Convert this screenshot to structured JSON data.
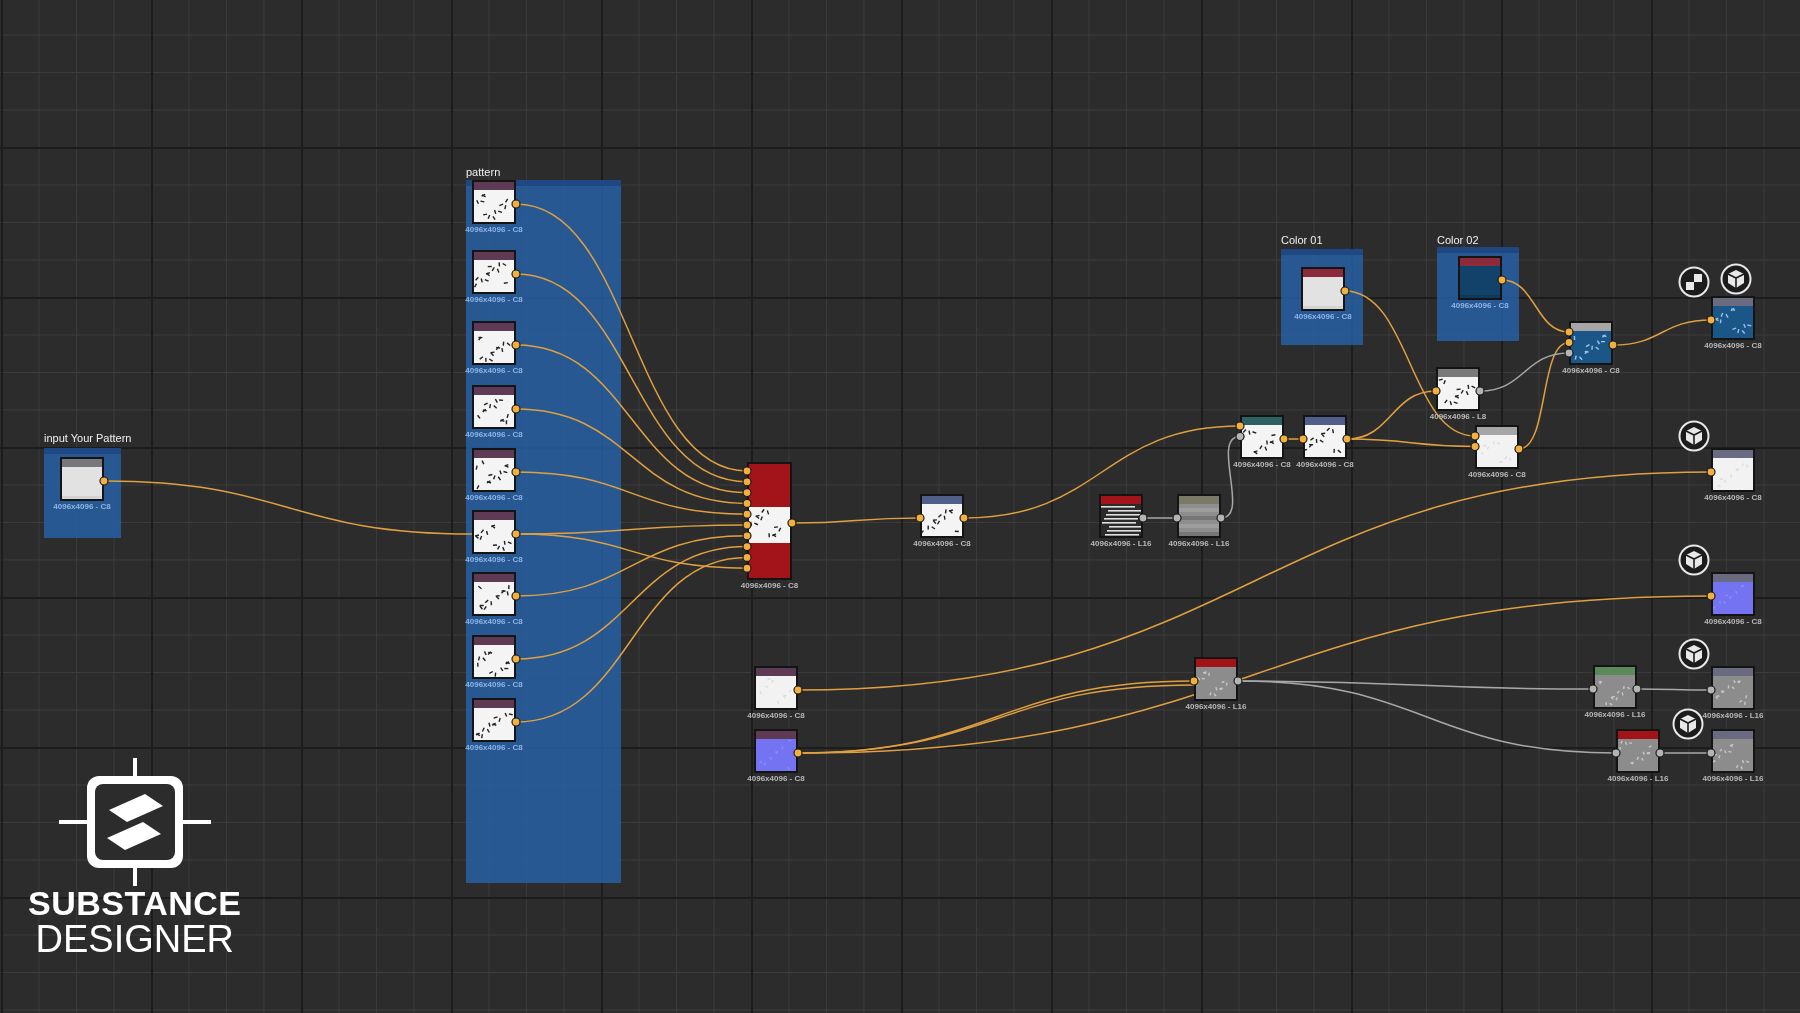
{
  "frames": [
    {
      "label": "input Your Pattern"
    },
    {
      "label": "pattern"
    },
    {
      "label": "Color 01"
    },
    {
      "label": "Color 02"
    }
  ],
  "nodes": [
    {
      "kind": "node",
      "color": "#77777c",
      "footer": "4096x4096 - C8"
    },
    {
      "kind": "node",
      "color": "#5e3a55",
      "footer": "4096x4096 - C8"
    },
    {
      "kind": "node",
      "color": "#5e3a55",
      "footer": "4096x4096 - C8"
    },
    {
      "kind": "node",
      "color": "#5e3a55",
      "footer": "4096x4096 - C8"
    },
    {
      "kind": "node",
      "color": "#5e3a55",
      "footer": "4096x4096 - C8"
    },
    {
      "kind": "node",
      "color": "#5e3a55",
      "footer": "4096x4096 - C8"
    },
    {
      "kind": "node",
      "color": "#5e3a55",
      "footer": "4096x4096 - C8"
    },
    {
      "kind": "node",
      "color": "#5e3a55",
      "footer": "4096x4096 - C8"
    },
    {
      "kind": "node",
      "color": "#5e3a55",
      "footer": "4096x4096 - C8"
    },
    {
      "kind": "node",
      "color": "#5e3a55",
      "footer": "4096x4096 - C8"
    },
    {
      "kind": "node",
      "color": "#8a2a3a",
      "footer": "4096x4096 - C8"
    },
    {
      "kind": "node",
      "color": "#8a2a3a",
      "footer": "4096x4096 - C8"
    },
    {
      "kind": "switch",
      "color": "#a3141a",
      "footer": "4096x4096 - C8"
    },
    {
      "kind": "node",
      "color": "#4f5f8a",
      "footer": "4096x4096 - C8"
    },
    {
      "kind": "node",
      "color": "#a3141a",
      "footer": "4096x4096 - L16"
    },
    {
      "kind": "node",
      "color": "#7a7a66",
      "footer": "4096x4096 - L16"
    },
    {
      "kind": "node",
      "color": "#2e6262",
      "footer": "4096x4096 - C8"
    },
    {
      "kind": "node",
      "color": "#4f5f8a",
      "footer": "4096x4096 - C8"
    },
    {
      "kind": "node",
      "color": "#7a7a7a",
      "footer": "4096x4096 - L8"
    },
    {
      "kind": "node",
      "color": "#a6a6a6",
      "footer": "4096x4096 - C8"
    },
    {
      "kind": "node",
      "color": "#a6a6a6",
      "footer": "4096x4096 - C8"
    },
    {
      "kind": "node",
      "color": "#6a6a80",
      "footer": "4096x4096 - C8"
    },
    {
      "kind": "node",
      "color": "#6a6a80",
      "footer": "4096x4096 - C8"
    },
    {
      "kind": "node",
      "color": "#5e3a55",
      "footer": "4096x4096 - C8"
    },
    {
      "kind": "node",
      "color": "#5e3a55",
      "footer": "4096x4096 - C8"
    },
    {
      "kind": "node",
      "color": "#a3141a",
      "footer": "4096x4096 - L16"
    },
    {
      "kind": "node",
      "color": "#6a6a80",
      "footer": "4096x4096 - C8"
    },
    {
      "kind": "node",
      "color": "#5a8a5a",
      "footer": "4096x4096 - L16"
    },
    {
      "kind": "node",
      "color": "#6a6a80",
      "footer": "4096x4096 - L16"
    },
    {
      "kind": "node",
      "color": "#a3141a",
      "footer": "4096x4096 - L16"
    },
    {
      "kind": "node",
      "color": "#6a6a80",
      "footer": "4096x4096 - L16"
    }
  ],
  "logo": {
    "line_1": "SUBSTANCE",
    "line_2": "DESIGNER"
  }
}
